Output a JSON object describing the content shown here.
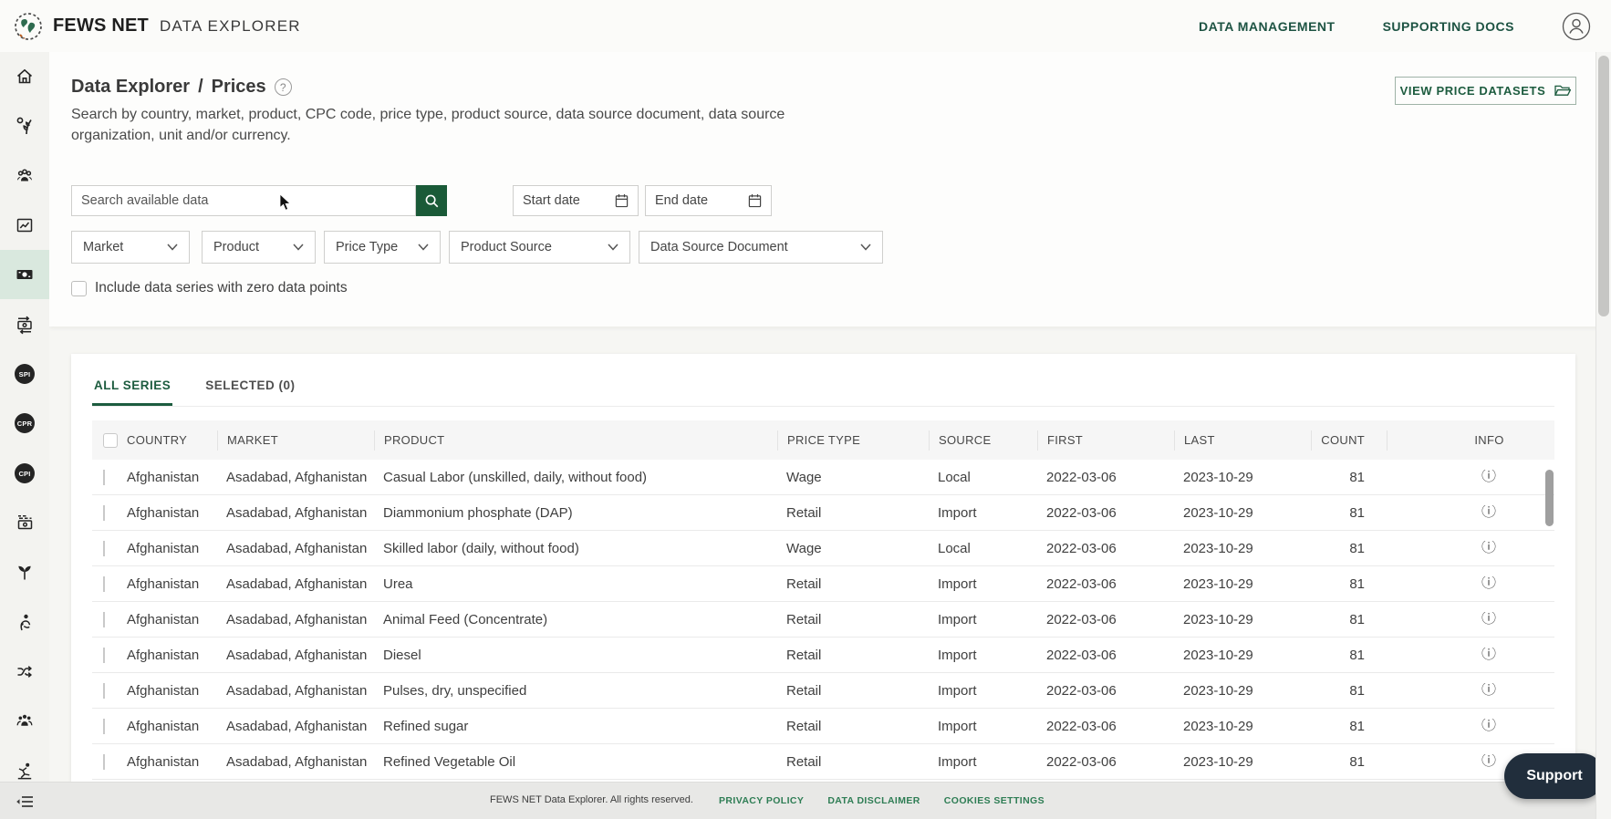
{
  "header": {
    "brand": {
      "name": "FEWS NET",
      "suffix": "DATA EXPLORER",
      "logo_icon": "globe-logo-icon"
    },
    "nav": [
      {
        "label": "DATA MANAGEMENT"
      },
      {
        "label": "SUPPORTING DOCS"
      }
    ],
    "avatar_icon": "user-avatar-icon"
  },
  "sidebar": {
    "items": [
      {
        "icon": "home-icon",
        "active": false
      },
      {
        "icon": "crop-coin-icon",
        "active": false
      },
      {
        "icon": "people-group-icon",
        "active": false
      },
      {
        "icon": "price-bulletin-icon",
        "active": false
      },
      {
        "icon": "banknote-icon",
        "active": true
      },
      {
        "icon": "banknote-exchange-icon",
        "active": false
      },
      {
        "icon": "spi-badge-icon",
        "badge": "SPI",
        "active": false
      },
      {
        "icon": "cpr-badge-icon",
        "badge": "CPR",
        "active": false
      },
      {
        "icon": "cpi-badge-icon",
        "badge": "CPI",
        "active": false
      },
      {
        "icon": "cash-flow-icon",
        "active": false
      },
      {
        "icon": "sprout-icon",
        "active": false
      },
      {
        "icon": "mother-child-icon",
        "active": false
      },
      {
        "icon": "flow-arrows-icon",
        "active": false
      },
      {
        "icon": "population-icon",
        "active": false
      },
      {
        "icon": "fieldwork-icon",
        "active": false
      }
    ],
    "collapse_icon": "collapse-menu-icon"
  },
  "page": {
    "breadcrumb": {
      "section": "Data Explorer",
      "separator": "/",
      "current": "Prices"
    },
    "help_icon": "?",
    "view_datasets_button": "VIEW PRICE DATASETS",
    "description": "Search by country, market, product, CPC code, price type, product source, data source document, data source organization, unit and/or currency."
  },
  "filters": {
    "search_placeholder": "Search available data",
    "start_date_placeholder": "Start date",
    "end_date_placeholder": "End date",
    "dropdowns": [
      {
        "label": "Market"
      },
      {
        "label": "Product"
      },
      {
        "label": "Price Type"
      },
      {
        "label": "Product Source"
      },
      {
        "label": "Data Source Document"
      }
    ],
    "zero_checkbox": {
      "label": "Include data series with zero data points",
      "checked": false
    }
  },
  "tabs": [
    {
      "label": "ALL SERIES",
      "active": true
    },
    {
      "label": "SELECTED (0)",
      "active": false
    }
  ],
  "table": {
    "columns": [
      "COUNTRY",
      "MARKET",
      "PRODUCT",
      "PRICE TYPE",
      "SOURCE",
      "FIRST",
      "LAST",
      "COUNT",
      "INFO"
    ],
    "rows": [
      {
        "country": "Afghanistan",
        "market": "Asadabad, Afghanistan",
        "product": "Casual Labor (unskilled, daily, without food)",
        "price_type": "Wage",
        "source": "Local",
        "first": "2022-03-06",
        "last": "2023-10-29",
        "count": "81"
      },
      {
        "country": "Afghanistan",
        "market": "Asadabad, Afghanistan",
        "product": "Diammonium phosphate (DAP)",
        "price_type": "Retail",
        "source": "Import",
        "first": "2022-03-06",
        "last": "2023-10-29",
        "count": "81"
      },
      {
        "country": "Afghanistan",
        "market": "Asadabad, Afghanistan",
        "product": "Skilled labor (daily, without food)",
        "price_type": "Wage",
        "source": "Local",
        "first": "2022-03-06",
        "last": "2023-10-29",
        "count": "81"
      },
      {
        "country": "Afghanistan",
        "market": "Asadabad, Afghanistan",
        "product": "Urea",
        "price_type": "Retail",
        "source": "Import",
        "first": "2022-03-06",
        "last": "2023-10-29",
        "count": "81"
      },
      {
        "country": "Afghanistan",
        "market": "Asadabad, Afghanistan",
        "product": "Animal Feed (Concentrate)",
        "price_type": "Retail",
        "source": "Import",
        "first": "2022-03-06",
        "last": "2023-10-29",
        "count": "81"
      },
      {
        "country": "Afghanistan",
        "market": "Asadabad, Afghanistan",
        "product": "Diesel",
        "price_type": "Retail",
        "source": "Import",
        "first": "2022-03-06",
        "last": "2023-10-29",
        "count": "81"
      },
      {
        "country": "Afghanistan",
        "market": "Asadabad, Afghanistan",
        "product": "Pulses, dry, unspecified",
        "price_type": "Retail",
        "source": "Import",
        "first": "2022-03-06",
        "last": "2023-10-29",
        "count": "81"
      },
      {
        "country": "Afghanistan",
        "market": "Asadabad, Afghanistan",
        "product": "Refined sugar",
        "price_type": "Retail",
        "source": "Import",
        "first": "2022-03-06",
        "last": "2023-10-29",
        "count": "81"
      },
      {
        "country": "Afghanistan",
        "market": "Asadabad, Afghanistan",
        "product": "Refined Vegetable Oil",
        "price_type": "Retail",
        "source": "Import",
        "first": "2022-03-06",
        "last": "2023-10-29",
        "count": "81"
      }
    ],
    "info_icon": "info-circle-icon"
  },
  "footer": {
    "copyright": "FEWS NET Data Explorer. All rights reserved.",
    "links": [
      {
        "label": "PRIVACY POLICY"
      },
      {
        "label": "DATA DISCLAIMER"
      },
      {
        "label": "COOKIES SETTINGS"
      }
    ]
  },
  "support_button": "Support",
  "colors": {
    "accent_green": "#1d5c3f",
    "search_button_green": "#1a5a38",
    "active_sidebar_bg": "#d9e8de",
    "footer_bg": "#e8e8e6",
    "support_button_bg": "#212e3c",
    "link_green": "#2e7d54"
  }
}
